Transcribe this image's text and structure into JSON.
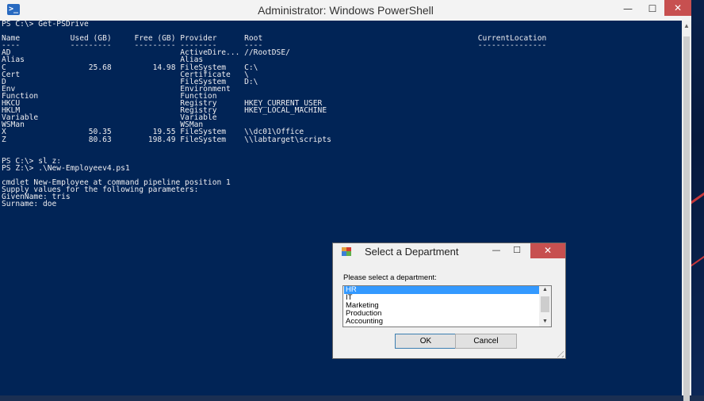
{
  "window": {
    "icon": "powershell-icon",
    "title": "Administrator: Windows PowerShell",
    "min_glyph": "—",
    "max_glyph": "☐",
    "close_glyph": "✕"
  },
  "console": {
    "lines": [
      "PS C:\\> Get-PSDrive",
      "",
      "Name           Used (GB)     Free (GB) Provider      Root                                               CurrentLocation",
      "----           ---------     --------- --------      ----                                               ---------------",
      "AD                                     ActiveDire... //RootDSE/",
      "Alias                                  Alias",
      "C                  25.68         14.98 FileSystem    C:\\",
      "Cert                                   Certificate   \\",
      "D                                      FileSystem    D:\\",
      "Env                                    Environment",
      "Function                               Function",
      "HKCU                                   Registry      HKEY_CURRENT_USER",
      "HKLM                                   Registry      HKEY_LOCAL_MACHINE",
      "Variable                               Variable",
      "WSMan                                  WSMan",
      "X                  50.35         19.55 FileSystem    \\\\dc01\\Office",
      "Z                  80.63        198.49 FileSystem    \\\\labtarget\\scripts",
      "",
      "",
      "PS C:\\> sl z:",
      "PS Z:\\> .\\New-Employeev4.ps1",
      "",
      "cmdlet New-Employee at command pipeline position 1",
      "Supply values for the following parameters:",
      "GivenName: tris",
      "Surname: doe"
    ]
  },
  "dialog": {
    "title": "Select a Department",
    "icon": "form-app-icon",
    "min_glyph": "—",
    "max_glyph": "☐",
    "close_glyph": "✕",
    "prompt": "Please select a department:",
    "departments": [
      "HR",
      "IT",
      "Marketing",
      "Production",
      "Accounting"
    ],
    "selected": "HR",
    "ok_label": "OK",
    "cancel_label": "Cancel"
  }
}
